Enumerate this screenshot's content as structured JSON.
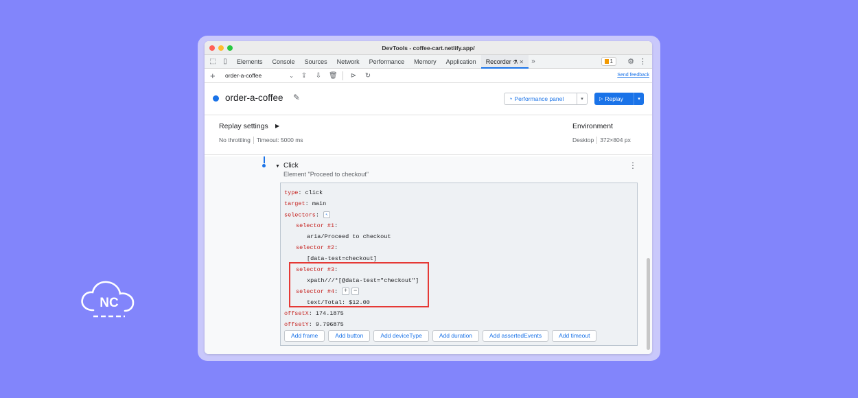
{
  "window": {
    "title": "DevTools - coffee-cart.netlify.app/"
  },
  "tabs": [
    {
      "label": "Elements"
    },
    {
      "label": "Console"
    },
    {
      "label": "Sources"
    },
    {
      "label": "Network"
    },
    {
      "label": "Performance"
    },
    {
      "label": "Memory"
    },
    {
      "label": "Application"
    },
    {
      "label": "Recorder"
    }
  ],
  "issues_badge": {
    "count": "1"
  },
  "toolbar": {
    "recording_select": "order-a-coffee",
    "send_feedback": "Send feedback"
  },
  "recording": {
    "name": "order-a-coffee",
    "performance_panel": "Performance panel",
    "replay": "Replay"
  },
  "replay_settings": {
    "title": "Replay settings",
    "throttling": "No throttling",
    "timeout": "Timeout: 5000 ms",
    "environment_title": "Environment",
    "device": "Desktop",
    "viewport": "372×804 px"
  },
  "step": {
    "title": "Click",
    "subtitle": "Element \"Proceed to checkout\"",
    "code": {
      "type_key": "type",
      "type_val": "click",
      "target_key": "target",
      "target_val": "main",
      "selectors_key": "selectors",
      "selector1_key": "selector #1",
      "selector1_val": "aria/Proceed to checkout",
      "selector2_key": "selector #2",
      "selector2_val": "[data-test=checkout]",
      "selector3_key": "selector #3",
      "selector3_val": "xpath///*[@data-test=\"checkout\"]",
      "selector4_key": "selector #4",
      "selector4_val": "text/Total: $12.00",
      "offsetx_key": "offsetX",
      "offsetx_val": "174.1875",
      "offsety_key": "offsetY",
      "offsety_val": "9.796875"
    },
    "add_buttons": [
      "Add frame",
      "Add button",
      "Add deviceType",
      "Add duration",
      "Add assertedEvents",
      "Add timeout"
    ]
  },
  "logo": {
    "text": "NC"
  },
  "colors": {
    "background": "#8285fb",
    "accent": "#1a73e8",
    "highlight": "#e53935",
    "code_key": "#c5221f"
  }
}
